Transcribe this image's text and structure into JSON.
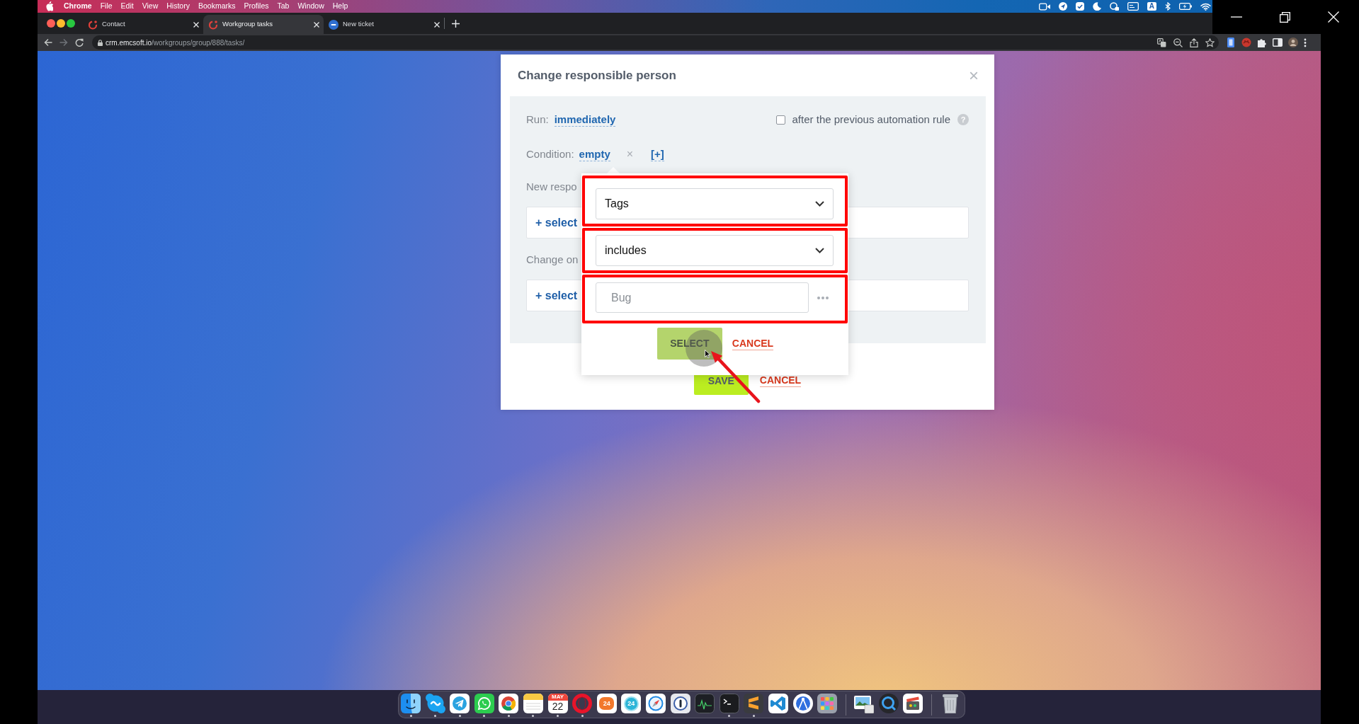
{
  "menu_bar": {
    "app": "Chrome",
    "items": [
      "File",
      "Edit",
      "View",
      "History",
      "Bookmarks",
      "Profiles",
      "Tab",
      "Window",
      "Help"
    ],
    "input_source": "A"
  },
  "browser": {
    "tabs": [
      {
        "title": "Contact",
        "selected": false
      },
      {
        "title": "Workgroup tasks",
        "selected": true
      },
      {
        "title": "New ticket",
        "selected": false
      }
    ],
    "nav": [
      {
        "kind": "back",
        "disabled": false
      },
      {
        "kind": "forward",
        "disabled": true
      },
      {
        "kind": "reload",
        "disabled": false
      }
    ],
    "url": {
      "host": "crm.emcsoft.io",
      "path": "/workgroups/group/888/tasks/"
    }
  },
  "dialog": {
    "title": "Change responsible person",
    "close": "×",
    "run": {
      "label": "Run:",
      "value": "immediately"
    },
    "after_previous": {
      "label": "after the previous automation rule",
      "checked": false,
      "help": "?"
    },
    "condition": {
      "label": "Condition:",
      "value": "empty",
      "remove": "×",
      "add": "[+]"
    },
    "fields": [
      {
        "label": "New respo",
        "action": "+ select"
      },
      {
        "label": "Change on",
        "action": "+ select"
      }
    ],
    "buttons": [
      {
        "kind": "primary",
        "label": "SAVE"
      },
      {
        "kind": "link",
        "label": "CANCEL"
      }
    ],
    "condition_popup": {
      "fields": [
        {
          "kind": "select",
          "value": "Tags",
          "highlighted": true
        },
        {
          "kind": "select",
          "value": "includes",
          "highlighted": true
        },
        {
          "kind": "input",
          "placeholder": "Bug",
          "highlighted": true
        }
      ],
      "buttons": [
        {
          "kind": "primary",
          "label": "SELECT",
          "hovered": true
        },
        {
          "kind": "link",
          "label": "CANCEL"
        }
      ]
    }
  },
  "dock": {
    "sections": [
      {
        "items": [
          {
            "running": true
          },
          {
            "running": true
          },
          {
            "running": true
          },
          {
            "running": true
          },
          {
            "running": true
          },
          {
            "running": true
          },
          {
            "running": true,
            "month": "MAY",
            "day": "22"
          },
          {
            "running": true
          },
          {
            "running": false,
            "label": "24"
          },
          {
            "running": false,
            "label": "24"
          },
          {
            "running": false
          },
          {
            "running": false
          },
          {
            "running": false
          },
          {
            "running": true
          },
          {
            "running": true
          },
          {
            "running": false
          },
          {
            "running": false
          },
          {
            "running": false
          }
        ]
      },
      {
        "items": [
          {
            "running": false
          },
          {
            "running": false
          },
          {
            "running": false
          }
        ]
      },
      {
        "items": [
          {
            "running": false
          }
        ]
      }
    ]
  }
}
